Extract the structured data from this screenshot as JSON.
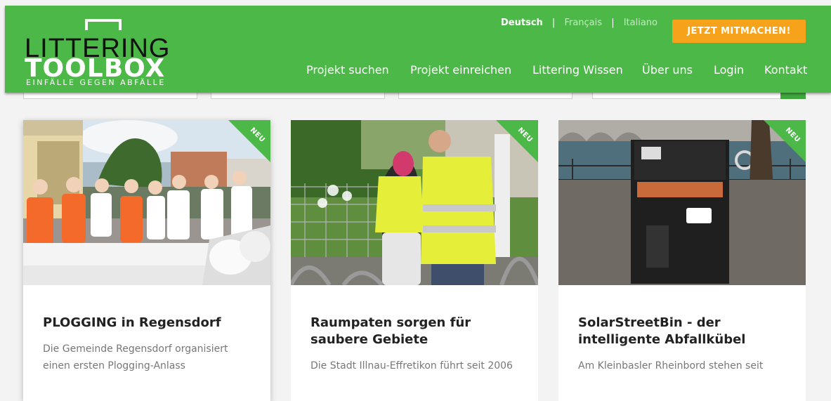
{
  "header": {
    "logo": {
      "line1": "LITTERING",
      "line2": "TOOLBOX",
      "tagline": "EINFÄLLE GEGEN ABFÄLLE"
    },
    "languages": {
      "active": "Deutsch",
      "other1": "Français",
      "other2": "Italiano",
      "separator": "|"
    },
    "cta_label": "JETZT MITMACHEN!",
    "nav": [
      "Projekt suchen",
      "Projekt einreichen",
      "Littering Wissen",
      "Über uns",
      "Login",
      "Kontakt"
    ]
  },
  "cards": [
    {
      "badge": "NEU",
      "title": "PLOGGING in Regensdorf",
      "excerpt": "Die Gemeinde Regensdorf organisiert einen ersten Plogging-Anlass"
    },
    {
      "badge": "NEU",
      "title": "Raumpaten sorgen für saubere Gebiete",
      "excerpt": "Die Stadt Illnau-Effretikon führt seit 2006"
    },
    {
      "badge": "NEU",
      "title": "SolarStreetBin - der intelligente Abfallkübel",
      "excerpt": "Am Kleinbasler Rheinbord stehen seit"
    }
  ],
  "colors": {
    "brand_green": "#4cb848",
    "cta_orange": "#f7a21b"
  }
}
